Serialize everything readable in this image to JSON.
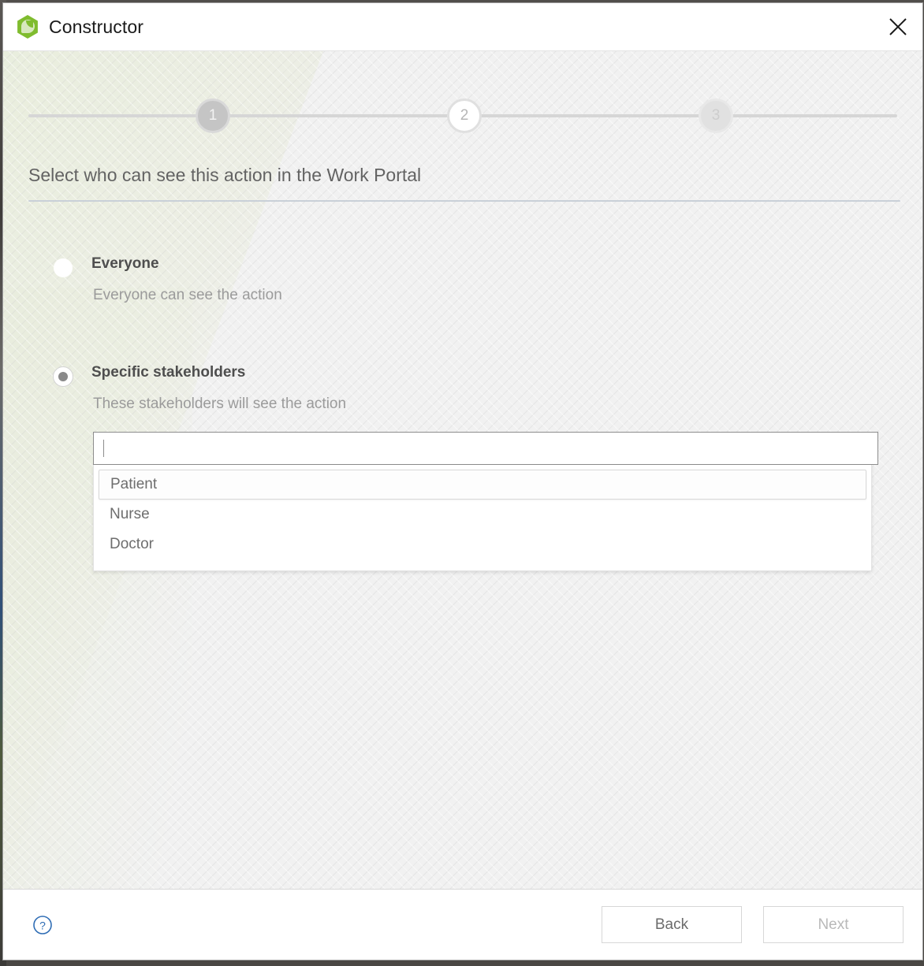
{
  "window": {
    "title": "Constructor",
    "logo_icon": "constructor-hexagon-logo",
    "close_icon": "close-icon"
  },
  "stepper": {
    "steps": [
      {
        "number": "1",
        "state": "completed"
      },
      {
        "number": "2",
        "state": "current"
      },
      {
        "number": "3",
        "state": "upcoming"
      }
    ]
  },
  "main": {
    "heading": "Select who can see this action in the Work Portal",
    "options": [
      {
        "label": "Everyone",
        "description": "Everyone can see the action",
        "selected": false
      },
      {
        "label": "Specific stakeholders",
        "description": "These stakeholders will see the action",
        "selected": true
      }
    ],
    "stakeholder_combobox": {
      "value": "",
      "placeholder": "",
      "options": [
        "Patient",
        "Nurse",
        "Doctor"
      ],
      "highlighted_option": "Patient"
    }
  },
  "footer": {
    "help_icon": "help-circle-icon",
    "back_label": "Back",
    "next_label": "Next",
    "next_enabled": false
  },
  "colors": {
    "brand_green": "#7fbc2e",
    "help_blue": "#2f6db5",
    "body_bg": "#f1f1f1",
    "heading_text": "#636363"
  }
}
